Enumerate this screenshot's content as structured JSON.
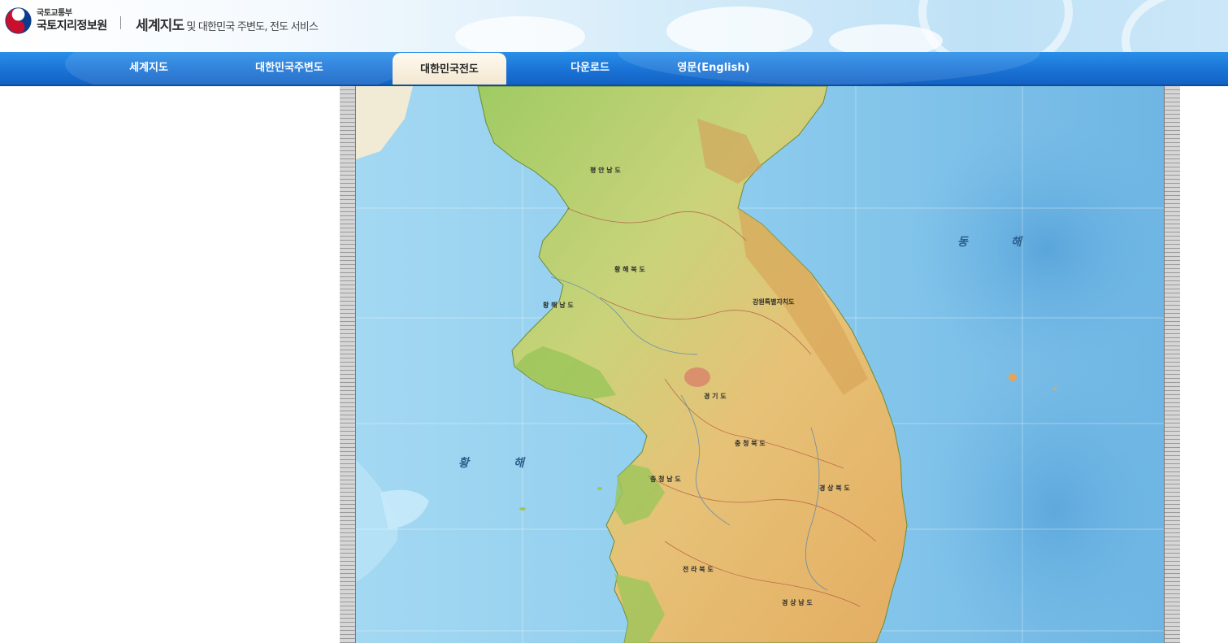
{
  "header": {
    "ministry": "국토교통부",
    "agency": "국토지리정보원",
    "title_main": "세계지도",
    "title_sub": "및 대한민국 주변도, 전도 서비스"
  },
  "nav": {
    "items": [
      {
        "label": "세계지도",
        "active": false
      },
      {
        "label": "대한민국주변도",
        "active": false
      },
      {
        "label": "대한민국전도",
        "active": true
      },
      {
        "label": "다운로드",
        "active": false
      },
      {
        "label": "영문(English)",
        "active": false
      }
    ]
  },
  "map": {
    "east_sea_1": "동",
    "east_sea_2": "해",
    "yellow_sea_1": "황",
    "yellow_sea_2": "해",
    "regions": [
      {
        "label": "평 안 남 도"
      },
      {
        "label": "황 해 북 도"
      },
      {
        "label": "황 해 남 도"
      },
      {
        "label": "강원특별자치도"
      },
      {
        "label": "경 기 도"
      },
      {
        "label": "충 청 북 도"
      },
      {
        "label": "충 청 남 도"
      },
      {
        "label": "경 상 북 도"
      },
      {
        "label": "전 라 북 도"
      },
      {
        "label": "경 상 남 도"
      }
    ]
  },
  "colors": {
    "nav_blue": "#1a73d6",
    "active_tab": "#f2e6cf",
    "sea": "#8fd0ef",
    "deep_sea": "#5aa8dc",
    "land_low": "#a9cf6a",
    "land_high": "#e8b866"
  }
}
